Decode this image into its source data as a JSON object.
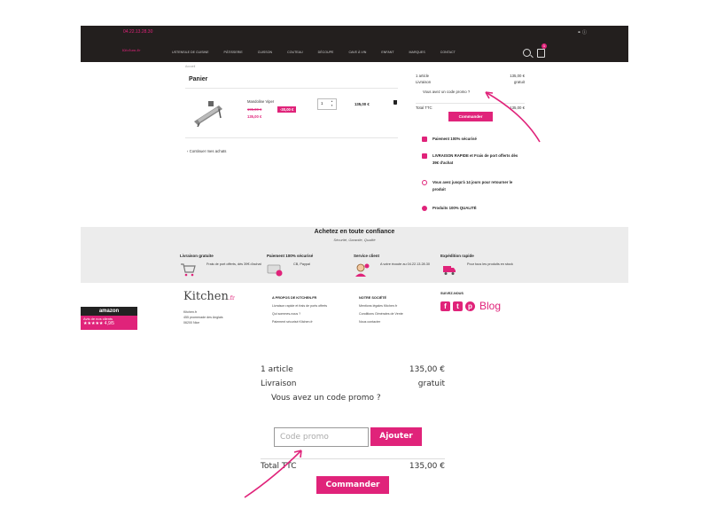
{
  "header": {
    "phone": "04.22.13.28.30",
    "logo": "Kitchen",
    "logo_suffix": ".fr",
    "nav": [
      "Ustensile de cuisine",
      "Pâtisserie",
      "Cuisson",
      "Couteau",
      "Découpe",
      "Cave à vin",
      "Enfant",
      "Marques",
      "Contact"
    ],
    "cart_count": "1",
    "accent": "#e0237a",
    "bg": "#231f1e"
  },
  "breadcrumb": "Accueil",
  "cart": {
    "title": "Panier",
    "product_name": "Mandoline Viper",
    "old_price": "195,00 €",
    "discount": "-30,00 €",
    "price": "135,00 €",
    "quantity": "1",
    "line_total": "135,00 €",
    "continue": "Continuer mes achats"
  },
  "summary": {
    "articles_label": "1 article",
    "articles_value": "135,00 €",
    "shipping_label": "Livraison",
    "shipping_value": "gratuit",
    "promo": "Vous avez un code promo ?",
    "total_label": "Total TTC",
    "total_value": "135,00 €",
    "order_button": "Commander"
  },
  "assurances": [
    {
      "text": "Paiement 100% sécurisé",
      "icon": "shield-icon"
    },
    {
      "text": "LIVRAISON RAPIDE et Frais de port offerts dès 39€ d'achat",
      "icon": "truck-icon"
    },
    {
      "text": "Vous avez jusqu'à 14 jours pour retourner le produit",
      "icon": "return-icon"
    },
    {
      "text": "Produits 100% QUALITÉ",
      "icon": "badge-icon"
    }
  ],
  "trust": {
    "title": "Achetez en toute confiance",
    "subtitle": "Sécurité, Garantie, Qualité",
    "columns": [
      {
        "title": "Livraison gratuite",
        "text": "Frais de port offerts, dès 39€ d'achat",
        "icon": "cart-icon"
      },
      {
        "title": "Paiement 100% sécurisé",
        "text": "CB, Paypal",
        "icon": "card-icon"
      },
      {
        "title": "Service client",
        "text": "A votre écoute au 04.22.13.28.30",
        "icon": "support-icon"
      },
      {
        "title": "Expédition rapide",
        "text": "Pour tous les produits en stock",
        "icon": "truck-icon"
      }
    ]
  },
  "footer": {
    "logo": "Kitchen",
    "logo_suffix": ".fr",
    "addr1": "Kitchen.fr",
    "addr2": "455 promenade des Anglais",
    "addr3": "06200 Nice",
    "amazon": "amazon",
    "amazon_reviews": "Avis de nos clients",
    "amazon_score": "★★★★★ 4,9/5",
    "col1_title": "A PROPOS DE KITCHEN.FR",
    "col1_items": [
      "Livraison rapide et frais de ports offerts",
      "Qui sommes-nous ?",
      "Paiement sécurisé Kitchen.fr"
    ],
    "col2_title": "NOTRE SOCIÉTÉ",
    "col2_items": [
      "Mentions légales Kitchen.fr",
      "Conditions Générales de Vente",
      "Nous contacter"
    ],
    "social_title": "SUIVEZ-NOUS",
    "blog": "Blog"
  },
  "zoom": {
    "articles_label": "1 article",
    "articles_value": "135,00 €",
    "shipping_label": "Livraison",
    "shipping_value": "gratuit",
    "promo_label": "Vous avez un code promo ?",
    "promo_placeholder": "Code promo",
    "apply_button": "Ajouter",
    "total_label": "Total TTC",
    "total_value": "135,00 €",
    "order_button": "Commander"
  }
}
